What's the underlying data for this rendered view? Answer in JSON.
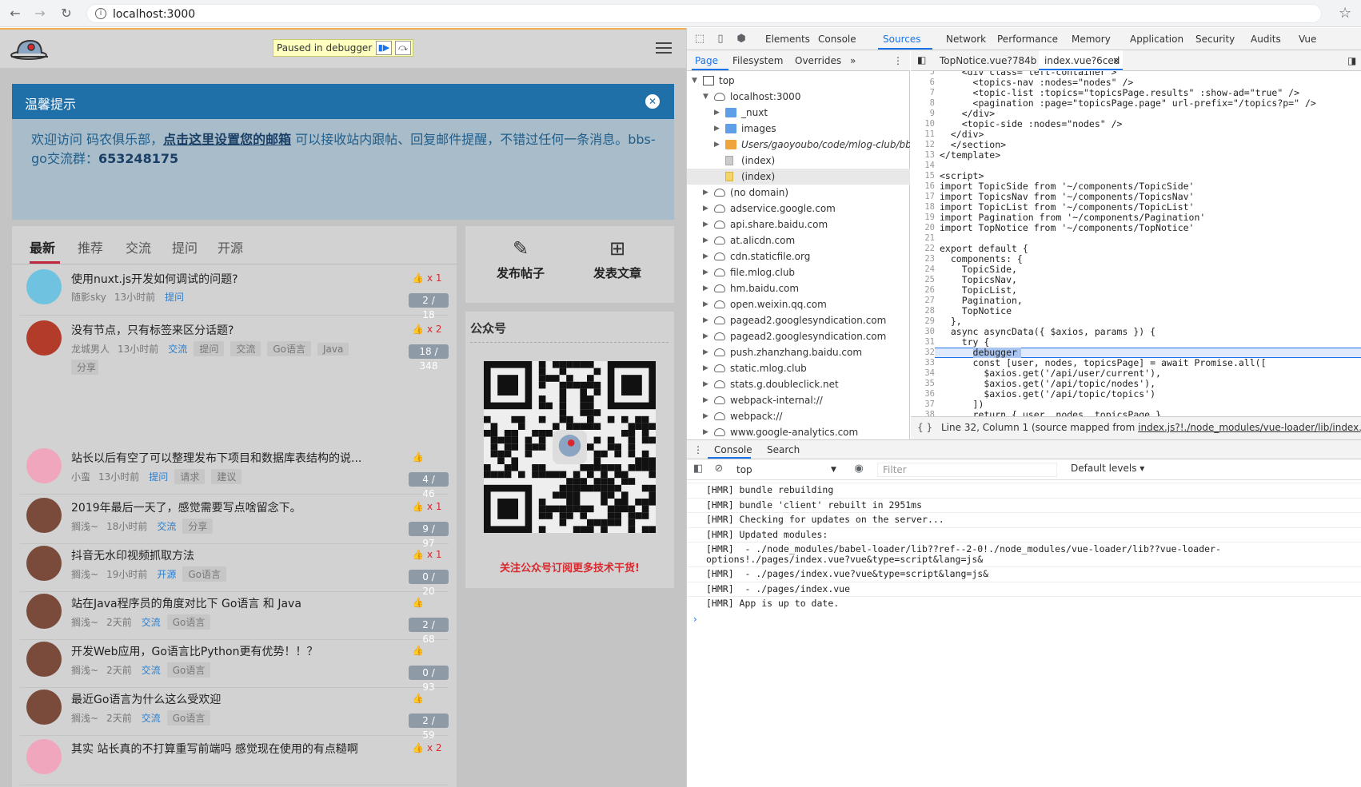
{
  "browser": {
    "url": "localhost:3000",
    "back_icon": "arrow-left-icon",
    "forward_icon": "arrow-right-icon",
    "reload_icon": "reload-icon",
    "bookmark_icon": "star-icon"
  },
  "page": {
    "debug_banner": "Paused in debugger",
    "notice": {
      "title": "温馨提示",
      "text_before": "欢迎访问 码农俱乐部，",
      "link": "点击这里设置您的邮箱",
      "text_after": " 可以接收站内跟帖、回复邮件提醒，不错过任何一条消息。bbs-go交流群：",
      "qq": "653248175"
    },
    "tabs": [
      "最新",
      "推荐",
      "交流",
      "提问",
      "开源"
    ],
    "topics": [
      {
        "title": "使用nuxt.js开发如何调试的问题?",
        "user": "随影sky",
        "time": "13小时前",
        "node": "提问",
        "tags": [],
        "likes": "x 1",
        "counts": "2 / 18"
      },
      {
        "title": "没有节点，只有标签来区分话题?",
        "user": "龙城男人",
        "time": "13小时前",
        "node": "交流",
        "tags": [
          "提问",
          "交流",
          "Go语言",
          "Java",
          "分享"
        ],
        "likes": "x 2",
        "counts": "18 / 348"
      },
      {
        "title": "站长以后有空了可以整理发布下项目和数据库表结构的说...",
        "user": "小蛮",
        "time": "13小时前",
        "node": "提问",
        "tags": [
          "请求",
          "建议"
        ],
        "likes": "",
        "counts": "4 / 46"
      },
      {
        "title": "2019年最后一天了，感觉需要写点啥留念下。",
        "user": "搁浅~",
        "time": "18小时前",
        "node": "交流",
        "tags": [
          "分享"
        ],
        "likes": "x 1",
        "counts": "9 / 97"
      },
      {
        "title": "抖音无水印视频抓取方法",
        "user": "搁浅~",
        "time": "19小时前",
        "node": "开源",
        "tags": [
          "Go语言"
        ],
        "likes": "x 1",
        "counts": "0 / 20"
      },
      {
        "title": "站在Java程序员的角度对比下 Go语言 和 Java",
        "user": "搁浅~",
        "time": "2天前",
        "node": "交流",
        "tags": [
          "Go语言"
        ],
        "likes": "",
        "counts": "2 / 68"
      },
      {
        "title": "开发Web应用，Go语言比Python更有优势！！？",
        "user": "搁浅~",
        "time": "2天前",
        "node": "交流",
        "tags": [
          "Go语言"
        ],
        "likes": "",
        "counts": "0 / 93"
      },
      {
        "title": "最近Go语言为什么这么受欢迎",
        "user": "搁浅~",
        "time": "2天前",
        "node": "交流",
        "tags": [
          "Go语言"
        ],
        "likes": "",
        "counts": "2 / 59"
      },
      {
        "title": "其实 站长真的不打算重写前端吗 感觉现在使用的有点糙啊",
        "user": "",
        "time": "",
        "node": "",
        "tags": [],
        "likes": "x 2",
        "counts": ""
      }
    ],
    "publish": {
      "post": "发布帖子",
      "article": "发表文章"
    },
    "wechat": {
      "title": "公众号",
      "subtitle": "关注公众号订阅更多技术干货!"
    }
  },
  "devtools": {
    "tabs": [
      "Elements",
      "Console",
      "Sources",
      "Network",
      "Performance",
      "Memory",
      "Application",
      "Security",
      "Audits",
      "Vue"
    ],
    "active_tab": "Sources",
    "nav_tabs": [
      "Page",
      "Filesystem",
      "Overrides",
      "»"
    ],
    "tree": [
      {
        "label": "top",
        "depth": 0,
        "icon": "frame",
        "arrow": "▼"
      },
      {
        "label": "localhost:3000",
        "depth": 1,
        "icon": "cloud",
        "arrow": "▼"
      },
      {
        "label": "_nuxt",
        "depth": 2,
        "icon": "folder",
        "arrow": "▶"
      },
      {
        "label": "images",
        "depth": 2,
        "icon": "folder",
        "arrow": "▶"
      },
      {
        "label": "Users/gaoyoubo/code/mlog-club/bbs-go",
        "depth": 2,
        "icon": "folder-orange",
        "arrow": "▶"
      },
      {
        "label": "(index)",
        "depth": 2,
        "icon": "file",
        "arrow": ""
      },
      {
        "label": "(index)",
        "depth": 2,
        "icon": "file-yellow",
        "arrow": "",
        "selected": true
      },
      {
        "label": "(no domain)",
        "depth": 1,
        "icon": "cloud",
        "arrow": "▶"
      },
      {
        "label": "adservice.google.com",
        "depth": 1,
        "icon": "cloud",
        "arrow": "▶"
      },
      {
        "label": "api.share.baidu.com",
        "depth": 1,
        "icon": "cloud",
        "arrow": "▶"
      },
      {
        "label": "at.alicdn.com",
        "depth": 1,
        "icon": "cloud",
        "arrow": "▶"
      },
      {
        "label": "cdn.staticfile.org",
        "depth": 1,
        "icon": "cloud",
        "arrow": "▶"
      },
      {
        "label": "file.mlog.club",
        "depth": 1,
        "icon": "cloud",
        "arrow": "▶"
      },
      {
        "label": "hm.baidu.com",
        "depth": 1,
        "icon": "cloud",
        "arrow": "▶"
      },
      {
        "label": "open.weixin.qq.com",
        "depth": 1,
        "icon": "cloud",
        "arrow": "▶"
      },
      {
        "label": "pagead2.googlesyndication.com",
        "depth": 1,
        "icon": "cloud",
        "arrow": "▶"
      },
      {
        "label": "pagead2.googlesyndication.com",
        "depth": 1,
        "icon": "cloud",
        "arrow": "▶"
      },
      {
        "label": "push.zhanzhang.baidu.com",
        "depth": 1,
        "icon": "cloud",
        "arrow": "▶"
      },
      {
        "label": "static.mlog.club",
        "depth": 1,
        "icon": "cloud",
        "arrow": "▶"
      },
      {
        "label": "stats.g.doubleclick.net",
        "depth": 1,
        "icon": "cloud",
        "arrow": "▶"
      },
      {
        "label": "webpack-internal://",
        "depth": 1,
        "icon": "cloud",
        "arrow": "▶"
      },
      {
        "label": "webpack://",
        "depth": 1,
        "icon": "cloud",
        "arrow": "▶"
      },
      {
        "label": "www.google-analytics.com",
        "depth": 1,
        "icon": "cloud",
        "arrow": "▶"
      }
    ],
    "editor_tabs": [
      "TopNotice.vue?784b",
      "index.vue?6ced"
    ],
    "code": [
      {
        "n": "5",
        "t": "    <div class=\"left-container\">"
      },
      {
        "n": "6",
        "t": "      <topics-nav :nodes=\"nodes\" />"
      },
      {
        "n": "7",
        "t": "      <topic-list :topics=\"topicsPage.results\" :show-ad=\"true\" />"
      },
      {
        "n": "8",
        "t": "      <pagination :page=\"topicsPage.page\" url-prefix=\"/topics?p=\" />"
      },
      {
        "n": "9",
        "t": "    </div>"
      },
      {
        "n": "10",
        "t": "    <topic-side :nodes=\"nodes\" />"
      },
      {
        "n": "11",
        "t": "  </div>"
      },
      {
        "n": "12",
        "t": "  </section>"
      },
      {
        "n": "13",
        "t": "</template>"
      },
      {
        "n": "14",
        "t": ""
      },
      {
        "n": "15",
        "t": "<script>"
      },
      {
        "n": "16",
        "t": "import TopicSide from '~/components/TopicSide'"
      },
      {
        "n": "17",
        "t": "import TopicsNav from '~/components/TopicsNav'"
      },
      {
        "n": "18",
        "t": "import TopicList from '~/components/TopicList'"
      },
      {
        "n": "19",
        "t": "import Pagination from '~/components/Pagination'"
      },
      {
        "n": "20",
        "t": "import TopNotice from '~/components/TopNotice'"
      },
      {
        "n": "21",
        "t": ""
      },
      {
        "n": "22",
        "t": "export default {"
      },
      {
        "n": "23",
        "t": "  components: {"
      },
      {
        "n": "24",
        "t": "    TopicSide,"
      },
      {
        "n": "25",
        "t": "    TopicsNav,"
      },
      {
        "n": "26",
        "t": "    TopicList,"
      },
      {
        "n": "27",
        "t": "    Pagination,"
      },
      {
        "n": "28",
        "t": "    TopNotice"
      },
      {
        "n": "29",
        "t": "  },"
      },
      {
        "n": "30",
        "t": "  async asyncData({ $axios, params }) {"
      },
      {
        "n": "31",
        "t": "    try {"
      },
      {
        "n": "32",
        "t": "      debugger"
      },
      {
        "n": "33",
        "t": "      const [user, nodes, topicsPage] = await Promise.all(["
      },
      {
        "n": "34",
        "t": "        $axios.get('/api/user/current'),"
      },
      {
        "n": "35",
        "t": "        $axios.get('/api/topic/nodes'),"
      },
      {
        "n": "36",
        "t": "        $axios.get('/api/topic/topics')"
      },
      {
        "n": "37",
        "t": "      ])"
      },
      {
        "n": "38",
        "t": "      return { user, nodes, topicsPage }"
      }
    ],
    "status": {
      "position": "Line 32, Column 1",
      "source_prefix": "(source mapped from ",
      "source_link": "index.js?!./node_modules/vue-loader/lib/index.js?!./pag"
    },
    "drawer_tabs": [
      "Console",
      "Search"
    ],
    "console": {
      "context": "top",
      "filter_placeholder": "Filter",
      "levels": "Default levels ▾",
      "messages": [
        "[HMR] bundle rebuilding",
        "[HMR] bundle 'client' rebuilt in 2951ms",
        "[HMR] Checking for updates on the server...",
        "[HMR] Updated modules:",
        "[HMR]  - ./node_modules/babel-loader/lib??ref--2-0!./node_modules/vue-loader/lib??vue-loader-\noptions!./pages/index.vue?vue&type=script&lang=js&",
        "[HMR]  - ./pages/index.vue?vue&type=script&lang=js&",
        "[HMR]  - ./pages/index.vue",
        "[HMR] App is up to date."
      ],
      "prompt": "›"
    }
  }
}
